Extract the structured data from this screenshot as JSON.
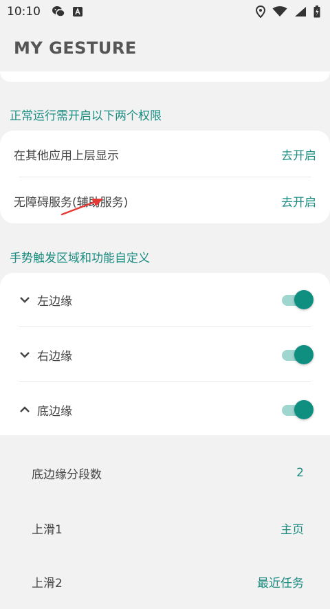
{
  "status_bar": {
    "time": "10:10",
    "left_icons": [
      "wechat-icon",
      "text-a-icon"
    ],
    "right_icons": [
      "location-icon",
      "wifi-icon",
      "signal-icon",
      "battery-icon"
    ]
  },
  "app": {
    "title": "MY GESTURE"
  },
  "permissions": {
    "section_title": "正常运行需开启以下两个权限",
    "items": [
      {
        "label": "在其他应用上层显示",
        "action": "去开启"
      },
      {
        "label": "无障碍服务(辅助服务)",
        "action": "去开启"
      }
    ]
  },
  "gestures": {
    "section_title": "手势触发区域和功能自定义",
    "items": [
      {
        "label": "左边缘",
        "expanded": false,
        "enabled": true
      },
      {
        "label": "右边缘",
        "expanded": false,
        "enabled": true
      },
      {
        "label": "底边缘",
        "expanded": true,
        "enabled": true
      }
    ],
    "bottom_options": [
      {
        "label": "底边缘分段数",
        "value": "2"
      },
      {
        "label": "上滑1",
        "value": "主页"
      },
      {
        "label": "上滑2",
        "value": "最近任务"
      }
    ]
  },
  "colors": {
    "accent": "#1a8c80",
    "toggle_thumb": "#0f8f80",
    "toggle_track": "#9fd6cf",
    "annotation_arrow": "#e53935"
  }
}
